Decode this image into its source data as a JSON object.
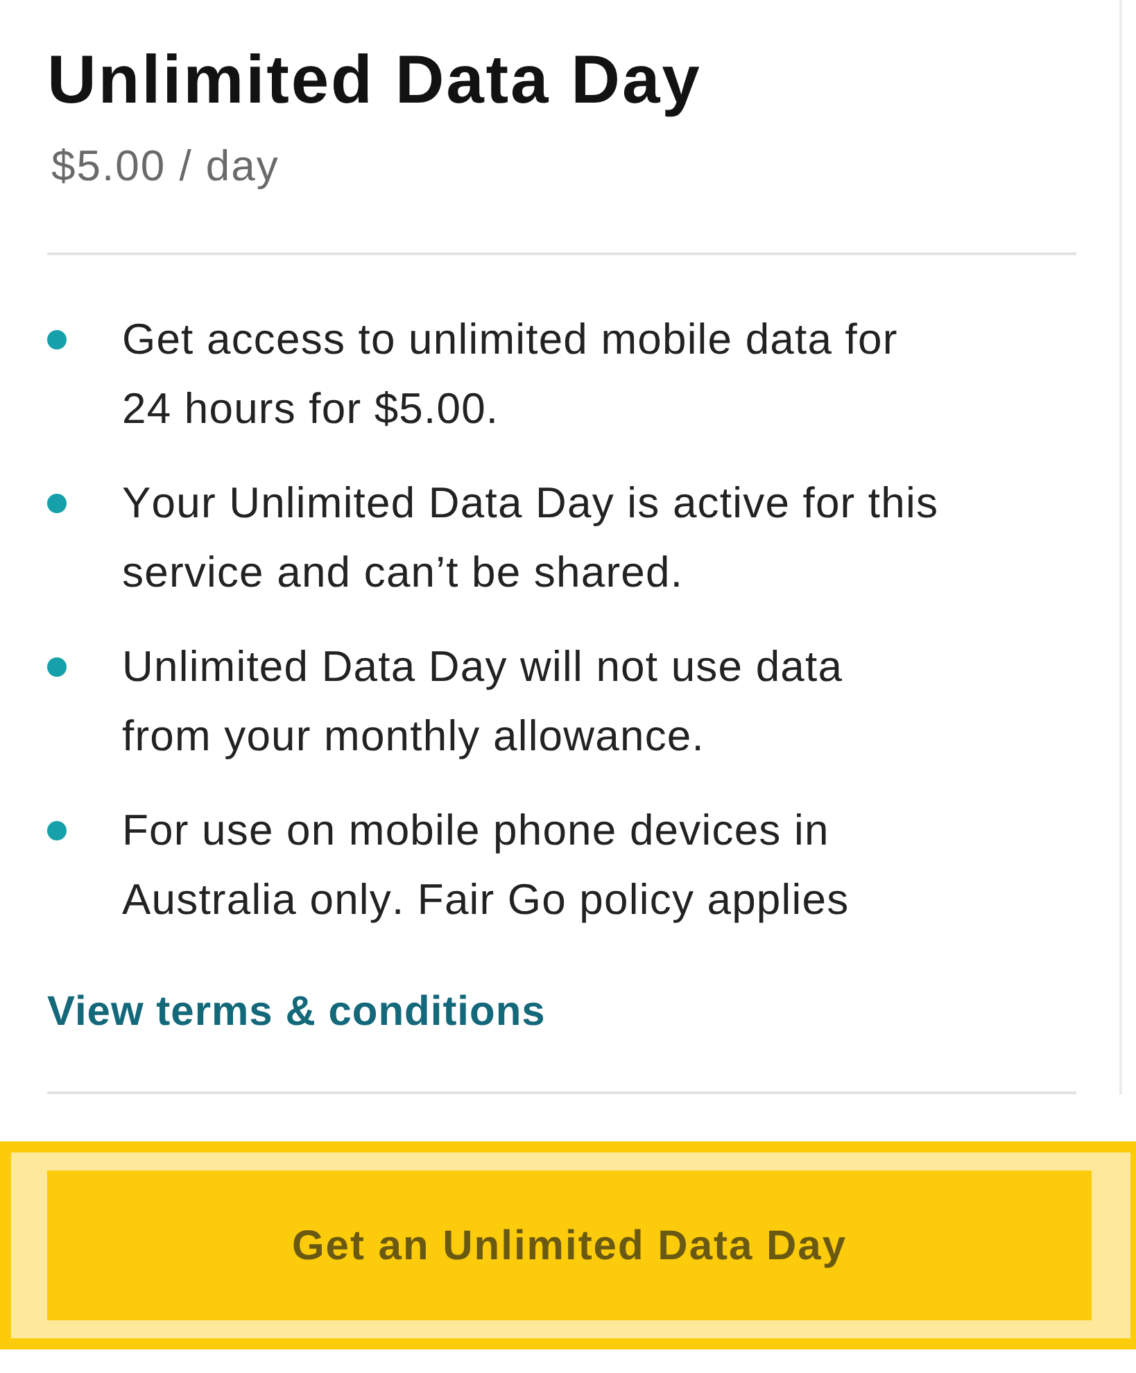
{
  "plan": {
    "title": "Unlimited Data Day",
    "price": "$5.00 / day"
  },
  "features": [
    "Get access to unlimited mobile data for 24 hours for $5.00.",
    "Your Unlimited Data Day is active for this service and can’t be shared.",
    "Unlimited Data Day will not use data from your monthly allowance.",
    "For use on mobile phone devices in Australia only. Fair Go policy applies"
  ],
  "terms_link": "View terms & conditions",
  "cta_button": {
    "label": "Get an Unlimited Data Day",
    "focused": true
  }
}
